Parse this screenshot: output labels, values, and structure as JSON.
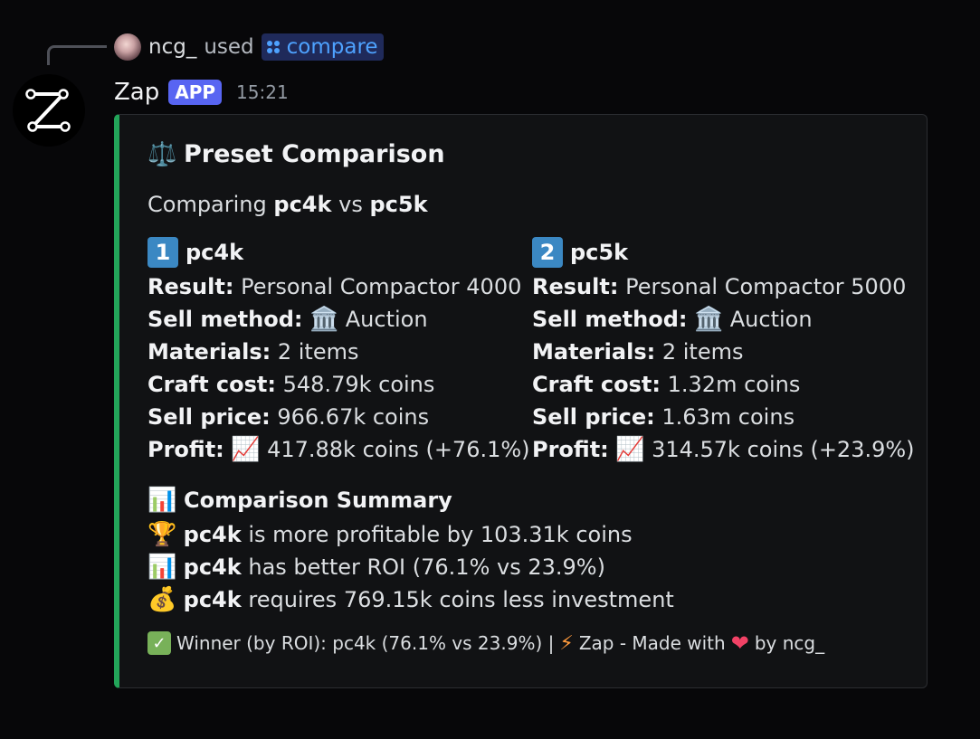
{
  "reply": {
    "username": "ncg_",
    "used_label": "used",
    "command": "compare"
  },
  "message": {
    "bot_name": "Zap",
    "badge": "APP",
    "timestamp": "15:21"
  },
  "embed": {
    "accent_color": "#23a55a",
    "title_emoji": "⚖️",
    "title": "Preset Comparison",
    "desc_prefix": "Comparing",
    "desc_a": "pc4k",
    "desc_vs": "vs",
    "desc_b": "pc5k",
    "fields": [
      {
        "number": "1",
        "name": "pc4k",
        "result_label": "Result:",
        "result": "Personal Compactor 4000",
        "sell_method_label": "Sell method:",
        "sell_method_emoji": "🏛️",
        "sell_method": "Auction",
        "materials_label": "Materials:",
        "materials": "2 items",
        "craft_cost_label": "Craft cost:",
        "craft_cost": "548.79k coins",
        "sell_price_label": "Sell price:",
        "sell_price": "966.67k coins",
        "profit_label": "Profit:",
        "profit_emoji": "📈",
        "profit": "417.88k coins (+76.1%)"
      },
      {
        "number": "2",
        "name": "pc5k",
        "result_label": "Result:",
        "result": "Personal Compactor 5000",
        "sell_method_label": "Sell method:",
        "sell_method_emoji": "🏛️",
        "sell_method": "Auction",
        "materials_label": "Materials:",
        "materials": "2 items",
        "craft_cost_label": "Craft cost:",
        "craft_cost": "1.32m coins",
        "sell_price_label": "Sell price:",
        "sell_price": "1.63m coins",
        "profit_label": "Profit:",
        "profit_emoji": "📈",
        "profit": "314.57k coins (+23.9%)"
      }
    ],
    "summary": {
      "emoji": "📊",
      "title": "Comparison Summary",
      "lines": [
        {
          "emoji": "🏆",
          "bold": "pc4k",
          "text": "is more profitable by 103.31k coins"
        },
        {
          "emoji": "📊",
          "bold": "pc4k",
          "text": "has better ROI (76.1% vs 23.9%)"
        },
        {
          "emoji": "💰",
          "bold": "pc4k",
          "text": "requires 769.15k coins less investment"
        }
      ]
    },
    "footer": {
      "check": "✓",
      "winner_text": "Winner (by ROI): pc4k (76.1% vs 23.9%) |",
      "bolt": "⚡",
      "made_with": "Zap - Made with",
      "heart": "❤",
      "by": "by ncg_"
    }
  }
}
